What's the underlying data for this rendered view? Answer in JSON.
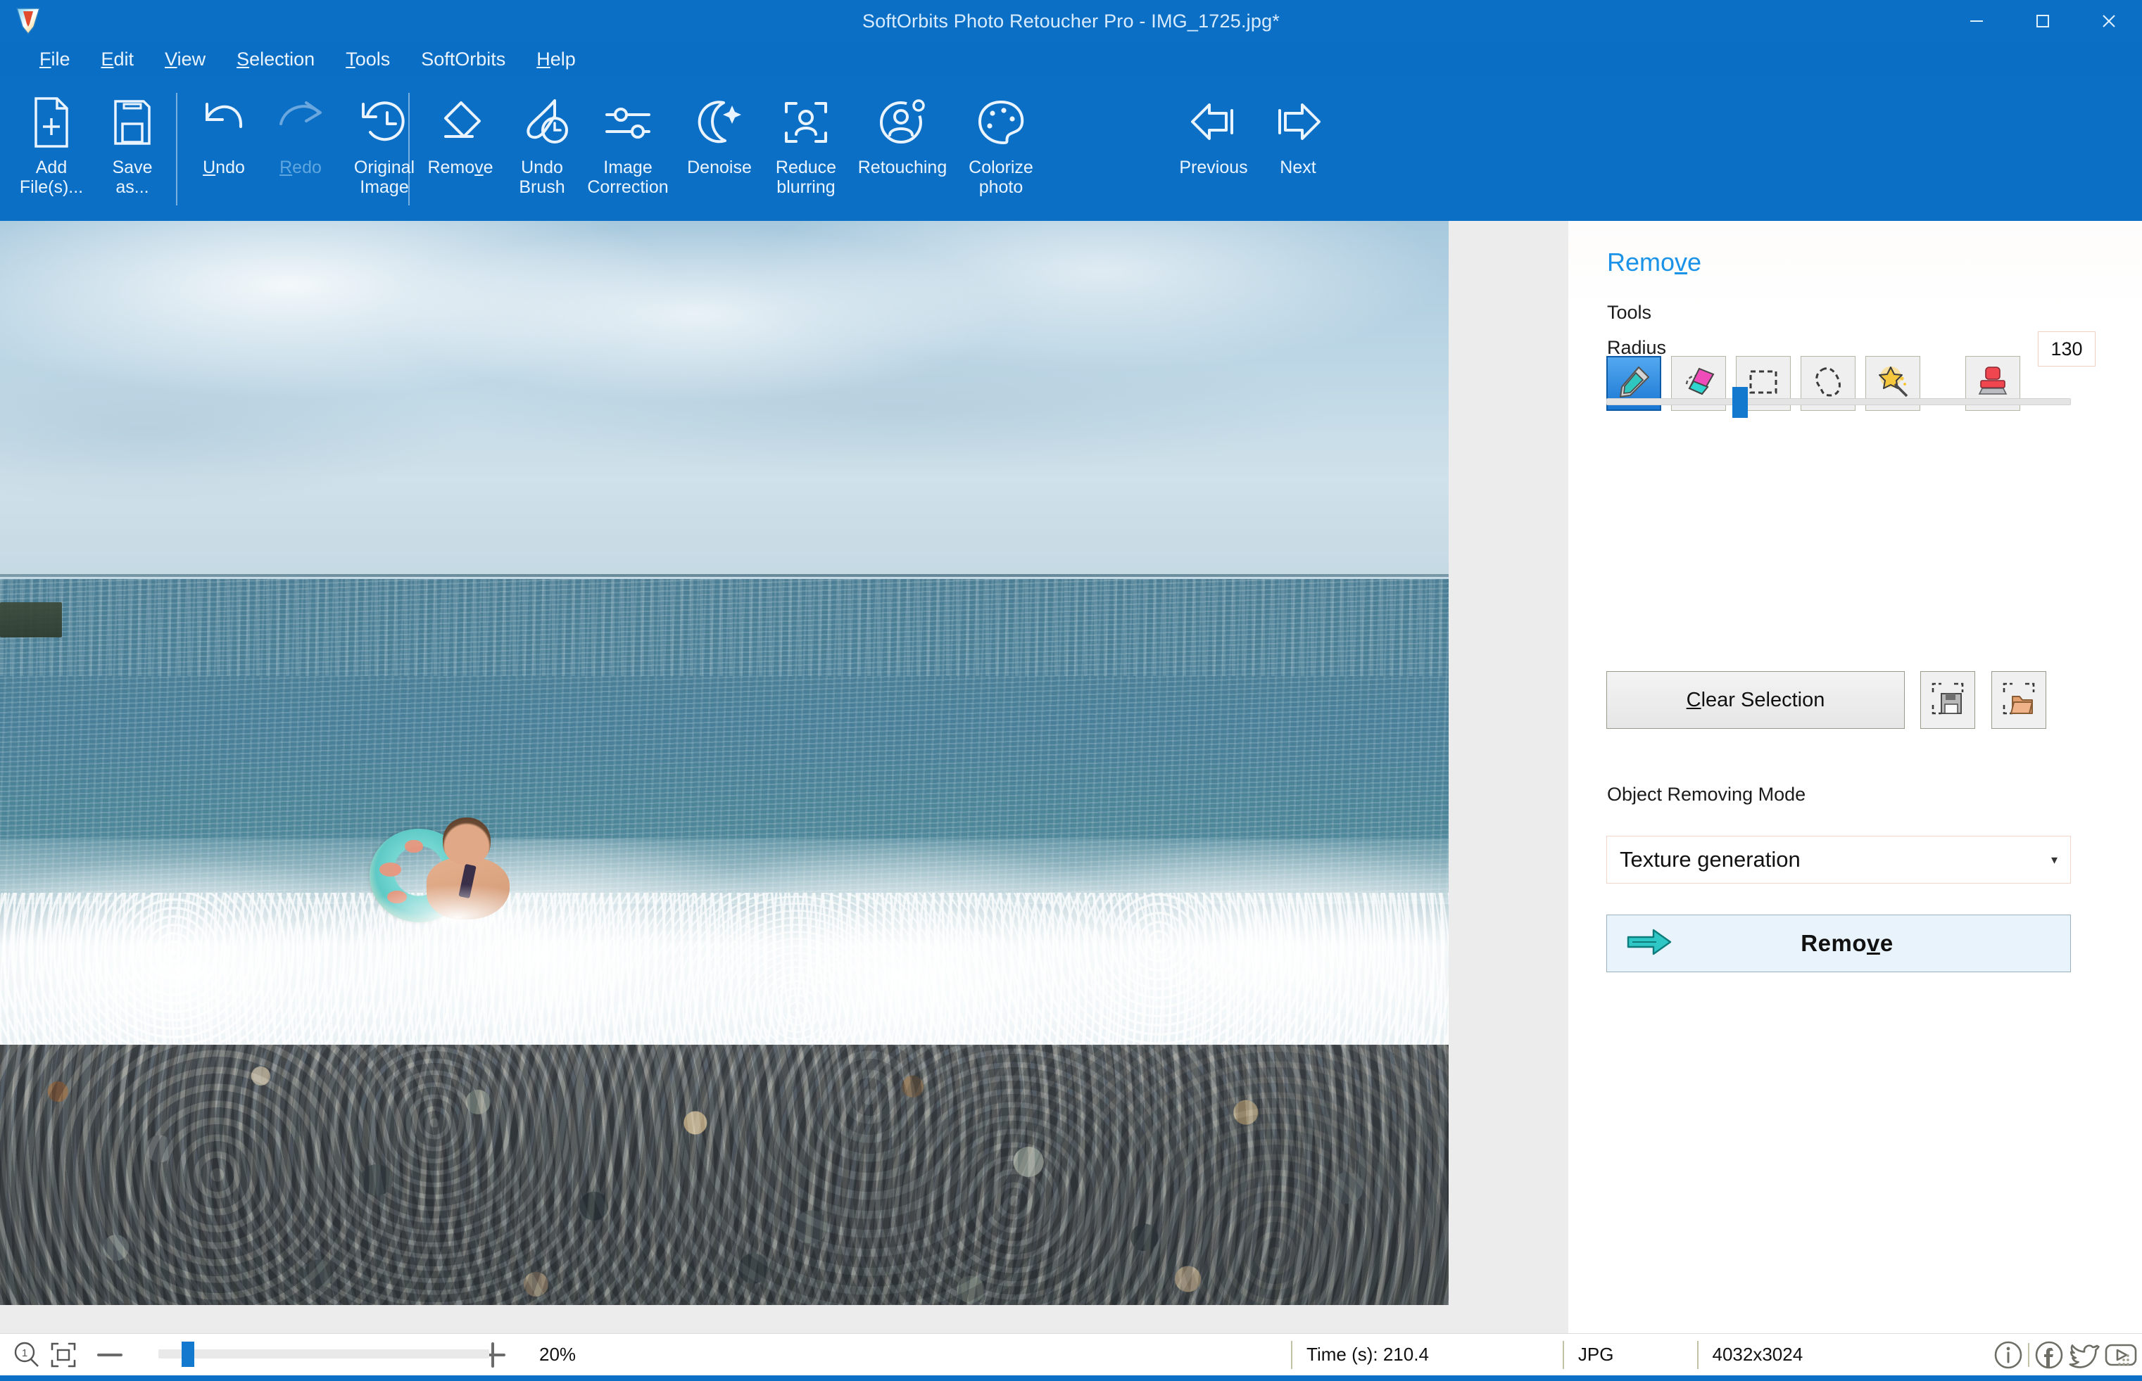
{
  "window": {
    "title": "SoftOrbits Photo Retoucher Pro - IMG_1725.jpg*",
    "app_icon": "softorbits-logo-icon",
    "minimize": "—",
    "maximize": "□",
    "close": "✕",
    "accent_blue": "#0b6fc6",
    "link_blue": "#1a92e8"
  },
  "menubar": {
    "items": [
      {
        "label": "File",
        "accel": "F"
      },
      {
        "label": "Edit",
        "accel": "E"
      },
      {
        "label": "View",
        "accel": "V"
      },
      {
        "label": "Selection",
        "accel": "S"
      },
      {
        "label": "Tools",
        "accel": "T"
      },
      {
        "label": "SoftOrbits",
        "accel": ""
      },
      {
        "label": "Help",
        "accel": "H"
      }
    ]
  },
  "ribbon": {
    "groups": [
      {
        "buttons": [
          {
            "label": "Add\nFile(s)...",
            "icon": "add-file-icon",
            "enabled": true
          },
          {
            "label": "Save\nas...",
            "icon": "save-as-icon",
            "enabled": true
          }
        ]
      },
      {
        "buttons": [
          {
            "label": "Undo",
            "icon": "undo-arrow-icon",
            "enabled": true
          },
          {
            "label": "Redo",
            "icon": "redo-arrow-icon",
            "enabled": false
          },
          {
            "label": "Original\nImage",
            "icon": "history-clock-icon",
            "enabled": true
          }
        ]
      },
      {
        "buttons": [
          {
            "label": "Remove",
            "icon": "eraser-icon",
            "enabled": true
          },
          {
            "label": "Undo\nBrush",
            "icon": "brush-clock-icon",
            "enabled": true
          },
          {
            "label": "Image\nCorrection",
            "icon": "sliders-icon",
            "enabled": true
          },
          {
            "label": "Denoise",
            "icon": "moon-sparkle-icon",
            "enabled": true
          },
          {
            "label": "Reduce\nblurring",
            "icon": "portrait-focus-icon",
            "enabled": true
          },
          {
            "label": "Retouching",
            "icon": "person-gear-icon",
            "enabled": true
          },
          {
            "label": "Colorize\nphoto",
            "icon": "palette-icon",
            "enabled": true
          }
        ]
      },
      {
        "buttons": [
          {
            "label": "Previous",
            "icon": "arrow-left-icon",
            "enabled": true
          },
          {
            "label": "Next",
            "icon": "arrow-right-icon",
            "enabled": true
          }
        ]
      }
    ]
  },
  "panel": {
    "title": "Remove",
    "title_accel": "v",
    "tools_label": "Tools",
    "tools": [
      {
        "name": "marker-tool",
        "icon": "marker-pen-icon",
        "selected": true
      },
      {
        "name": "eraser-tool",
        "icon": "eraser-pink-icon",
        "selected": false
      },
      {
        "name": "rectangle-select-tool",
        "icon": "rectangle-marquee-icon",
        "selected": false
      },
      {
        "name": "lasso-tool",
        "icon": "lasso-icon",
        "selected": false
      },
      {
        "name": "magic-wand-tool",
        "icon": "magic-wand-icon",
        "selected": false
      },
      {
        "name": "stamp-tool",
        "icon": "clone-stamp-icon",
        "selected": false
      }
    ],
    "radius_label": "Radius",
    "radius_value": "130",
    "radius_slider_percent": 27,
    "clear_selection_label": "Clear Selection",
    "clear_selection_accel": "C",
    "save_selection_icon": "save-selection-icon",
    "load_selection_icon": "load-selection-icon",
    "mode_label": "Object Removing Mode",
    "mode_value": "Texture generation",
    "mode_arrow": "▾",
    "remove_button_label": "Remove",
    "remove_button_accel": "v",
    "remove_button_icon": "arrow-right-teal-icon"
  },
  "statusbar": {
    "zoom_one_icon": "zoom-actual-size-icon",
    "fit_icon": "fit-to-window-icon",
    "minus_label": "—",
    "plus_label": "+",
    "zoom_value": "20%",
    "zoom_slider_percent": 7,
    "time_label": "Time (s): 210.4",
    "format_label": "JPG",
    "dimensions_label": "4032x3024",
    "icons": [
      {
        "name": "info-icon",
        "label": "i"
      },
      {
        "name": "facebook-icon",
        "label": "f"
      },
      {
        "name": "twitter-icon",
        "label": "t"
      },
      {
        "name": "youtube-icon",
        "label": "y"
      }
    ],
    "resize_grip_icon": "resize-grip-icon"
  },
  "image": {
    "filename": "IMG_1725.jpg",
    "description": "beach-photo-woman-in-inner-tube-in-surf",
    "zoom_percent": "20%",
    "format": "JPG",
    "dimensions": "4032x3024"
  }
}
